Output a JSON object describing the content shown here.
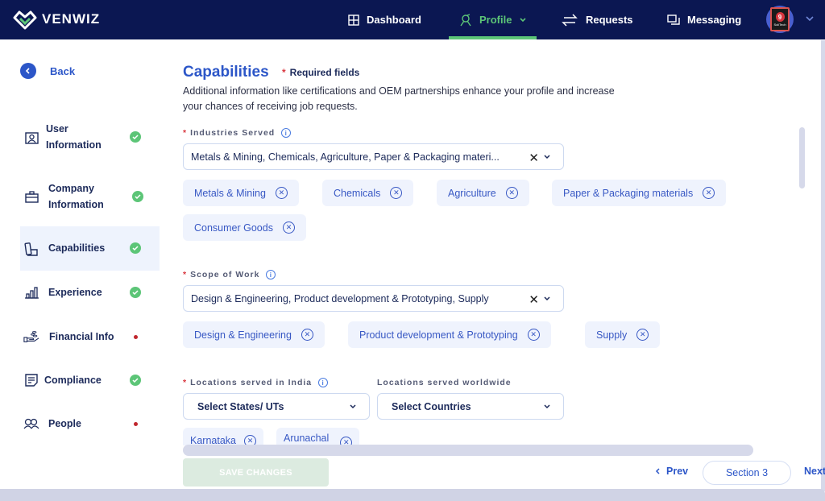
{
  "header": {
    "brand": "VENWIZ",
    "nav": [
      {
        "label": "Dashboard",
        "icon": "grid-icon"
      },
      {
        "label": "Profile",
        "icon": "profile-icon",
        "active": true
      },
      {
        "label": "Requests",
        "icon": "swap-arrows-icon"
      },
      {
        "label": "Messaging",
        "icon": "chat-icon"
      }
    ],
    "avatar_label": "9",
    "avatar_caption": "SoliTech"
  },
  "sidebar": {
    "back_label": "Back",
    "items": [
      {
        "label_line1": "User",
        "label_line2": "Information",
        "status": "complete"
      },
      {
        "label_line1": "Company",
        "label_line2": "Information",
        "status": "complete"
      },
      {
        "label": "Capabilities",
        "status": "complete",
        "active": true
      },
      {
        "label": "Experience",
        "status": "complete"
      },
      {
        "label": "Financial Info",
        "status": "incomplete"
      },
      {
        "label": "Compliance",
        "status": "complete"
      },
      {
        "label": "People",
        "status": "incomplete"
      }
    ]
  },
  "main": {
    "title": "Capabilities",
    "required_note": "Required fields",
    "description": "Additional information like certifications and OEM partnerships enhance your profile and increase your chances of receiving job requests.",
    "industries": {
      "label": "Industries Served",
      "value": "Metals & Mining, Chemicals, Agriculture, Paper & Packaging materi...",
      "chips": [
        "Metals & Mining",
        "Chemicals",
        "Agriculture",
        "Paper & Packaging materials",
        "Consumer Goods"
      ]
    },
    "scope": {
      "label": "Scope of Work",
      "value": "Design & Engineering, Product development & Prototyping, Supply",
      "chips": [
        "Design & Engineering",
        "Product development & Prototyping",
        "Supply"
      ]
    },
    "locations_india": {
      "label": "Locations served in India",
      "placeholder": "Select States/ UTs",
      "chips": [
        "Karnataka",
        "Arunachal"
      ]
    },
    "locations_world": {
      "label": "Locations served worldwide",
      "placeholder": "Select Countries"
    }
  },
  "footer": {
    "save_label": "SAVE CHANGES",
    "prev_label": "Prev",
    "section_label": "Section 3",
    "next_label": "Next"
  },
  "colors": {
    "navbar": "#0b1752",
    "accent_green": "#5cc577",
    "primary_blue": "#2c56c8",
    "chip_bg": "#eff3fd",
    "error_red": "#c0262d"
  }
}
